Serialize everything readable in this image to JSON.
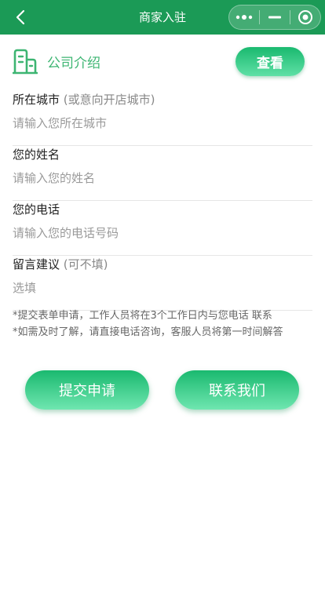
{
  "navbar": {
    "title": "商家入驻",
    "back_icon": "chevron-left-icon",
    "capsule": {
      "more_icon": "more-dots-icon",
      "minimize_icon": "minimize-icon",
      "close_icon": "target-circle-icon"
    },
    "background": "#1b9a56"
  },
  "intro": {
    "icon": "building-icon",
    "title": "公司介绍",
    "view_label": "查看"
  },
  "form": {
    "city": {
      "label": "所在城市",
      "hint": "(或意向开店城市)",
      "placeholder": "请输入您所在城市",
      "value": ""
    },
    "name": {
      "label": "您的姓名",
      "placeholder": "请输入您的姓名",
      "value": ""
    },
    "phone": {
      "label": "您的电话",
      "placeholder": "请输入您的电话号码",
      "value": ""
    },
    "suggestion": {
      "label": "留言建议",
      "hint": "(可不填)",
      "placeholder": "选填",
      "value": ""
    }
  },
  "notes": [
    "*提交表单申请，工作人员将在3个工作日内与您电话 联系",
    "*如需及时了解，请直接电话咨询，客服人员将第一时间解答"
  ],
  "actions": {
    "submit_label": "提交申请",
    "contact_label": "联系我们"
  },
  "colors": {
    "accent": "#3db572",
    "button_top": "#1ab96f",
    "button_bottom": "#6fe6b0"
  }
}
